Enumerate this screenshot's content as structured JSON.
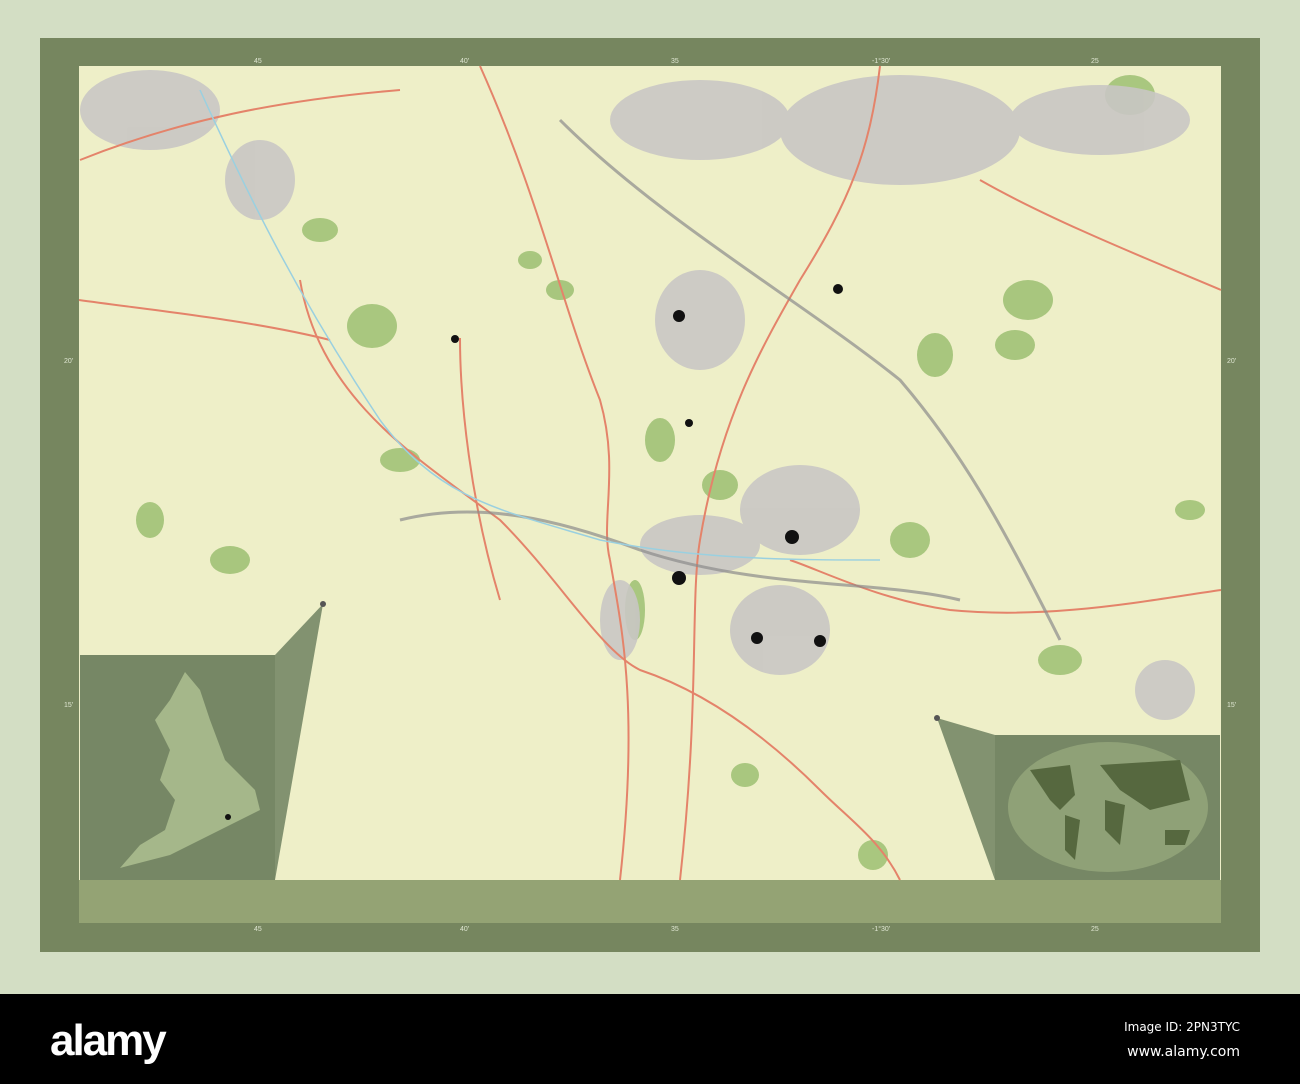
{
  "map": {
    "top_ticks": [
      "45",
      "40'",
      "35",
      "-1°30'",
      "25"
    ],
    "bottom_ticks": [
      "45",
      "40'",
      "35",
      "-1°30'",
      "25"
    ],
    "left_ticks": [
      "20'",
      "15'"
    ],
    "right_ticks": [
      "20'",
      "15'"
    ],
    "colors": {
      "frame": "#76865f",
      "land": "#eeefc8",
      "urban": "#c9c6c4",
      "green": "#93b56a",
      "road": "#e4836a",
      "inset": "#6f8160"
    }
  },
  "footer": {
    "logo": "alamy",
    "image_id": "Image ID: 2PN3TYC",
    "url": "www.alamy.com"
  }
}
